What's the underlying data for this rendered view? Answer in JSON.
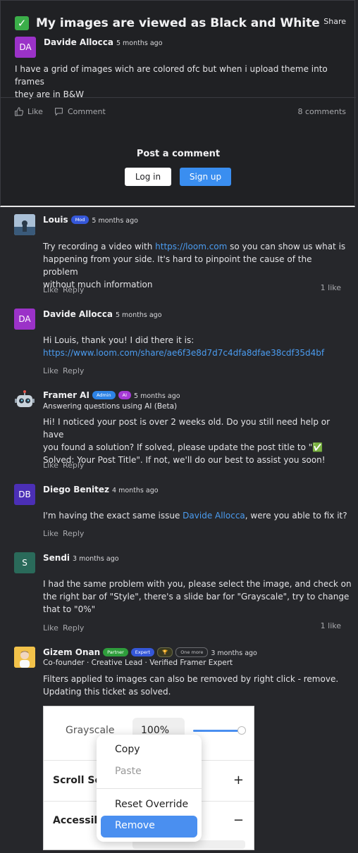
{
  "post": {
    "check_icon": "✓",
    "title": "My images are viewed as Black and White",
    "share_label": "Share",
    "author_initials": "DA",
    "author_name": "Davide Allocca",
    "time": "5 months ago",
    "body_line1": "I have a grid of images wich are colored ofc but when i upload theme into frames",
    "body_line2": "they are in B&W",
    "like_label": "Like",
    "comment_label": "Comment",
    "comments_count": "8 comments",
    "post_comment_heading": "Post a comment",
    "login_label": "Log in",
    "signup_label": "Sign up"
  },
  "comments": [
    {
      "author": "Louis",
      "badges": [
        "Mod"
      ],
      "time": "5 months ago",
      "text_pre": "Try recording a video with ",
      "link": "https://loom.com",
      "text_post_1": " so you can show us what is",
      "line2": "happening from your side. It's hard to pinpoint the cause of the problem",
      "line3": "without much information",
      "like": "Like",
      "reply": "Reply",
      "likes": "1 like"
    },
    {
      "author": "Davide Allocca",
      "initials": "DA",
      "time": "5 months ago",
      "line1": "Hi Louis, thank you! I did there it is:",
      "link": "https://www.loom.com/share/ae6f3e8d7d7c4dfa8dfae38cdf35d4bf",
      "like": "Like",
      "reply": "Reply"
    },
    {
      "author": "Framer AI",
      "badges": [
        "Admin",
        "AI"
      ],
      "time": "5 months ago",
      "subtitle": "Answering questions using AI (Beta)",
      "line1": "Hi! I noticed your post is over 2 weeks old. Do you still need help or have",
      "line2": "you found a solution? If solved, please update the post title to \"✅",
      "line3": "Solved: Your Post Title\". If not, we'll do our best to assist you soon!",
      "like": "Like",
      "reply": "Reply"
    },
    {
      "author": "Diego Benitez",
      "initials": "DB",
      "time": "4 months ago",
      "text_pre": "I'm having the exact same issue ",
      "mention": "Davide Allocca",
      "text_post": ", were you able to fix it?",
      "like": "Like",
      "reply": "Reply"
    },
    {
      "author": "Sendi",
      "initials": "S",
      "time": "3 months ago",
      "line1": "I had the same problem with you, please select the image, and check on",
      "line2": "the right bar of \"Style\", there's a slide bar for \"Grayscale\", try to change",
      "line3": "that to \"0%\"",
      "like": "Like",
      "reply": "Reply",
      "likes": "1 like"
    },
    {
      "author": "Gizem Onan",
      "badges": [
        "Partner",
        "Expert",
        "🏆",
        "One more"
      ],
      "time": "3 months ago",
      "subtitle": "Co-founder · Creative Lead · Verified Framer Expert",
      "line1": "Filters applied to images can also be removed by right click - remove.",
      "line2": "Updating this ticket as solved."
    }
  ],
  "screenshot": {
    "grayscale_label": "Grayscale",
    "grayscale_value": "100%",
    "grayscale_level": 1.0,
    "section1": "Scroll Se",
    "section2": "Accessib",
    "plus": "+",
    "minus": "−",
    "menu": {
      "copy": "Copy",
      "paste": "Paste",
      "reset": "Reset Override",
      "remove": "Remove"
    }
  },
  "colors": {
    "accent": "#3a8ef0",
    "link": "#4b9cf0",
    "avatar_davide": "#9b32c8",
    "avatar_diego": "#4b2fb6",
    "avatar_sendi": "#2a6a5a"
  }
}
